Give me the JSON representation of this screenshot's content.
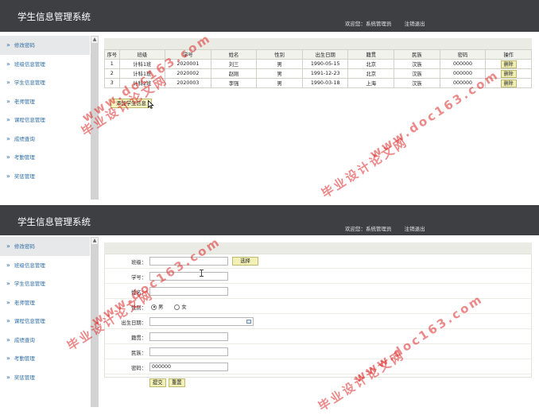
{
  "app": {
    "title": "学生信息管理系统",
    "welcome": "欢迎您：系统管理员",
    "logout": "注销退出"
  },
  "sidebar": {
    "items": [
      {
        "label": "修改密码"
      },
      {
        "label": "班级信息管理"
      },
      {
        "label": "学生信息管理"
      },
      {
        "label": "老师管理"
      },
      {
        "label": "课程信息管理"
      },
      {
        "label": "成绩查询"
      },
      {
        "label": "考勤管理"
      },
      {
        "label": "奖惩管理"
      }
    ]
  },
  "list_view": {
    "columns": [
      "序号",
      "班级",
      "学号",
      "姓名",
      "性别",
      "出生日期",
      "籍贯",
      "民族",
      "密码",
      "操作"
    ],
    "rows": [
      {
        "no": "1",
        "class": "计科1班",
        "id": "2020001",
        "name": "刘三",
        "gender": "男",
        "birth": "1990-05-15",
        "native": "北京",
        "ethnic": "汉族",
        "password": "000000",
        "action": "删除"
      },
      {
        "no": "2",
        "class": "计科1班",
        "id": "2020002",
        "name": "赵刚",
        "gender": "男",
        "birth": "1991-12-23",
        "native": "北京",
        "ethnic": "汉族",
        "password": "000000",
        "action": "删除"
      },
      {
        "no": "3",
        "class": "计科2班",
        "id": "2020003",
        "name": "李强",
        "gender": "男",
        "birth": "1990-03-18",
        "native": "上海",
        "ethnic": "汉族",
        "password": "000000",
        "action": "删除"
      }
    ],
    "add_button": "添加学生信息"
  },
  "form_view": {
    "class_label": "班级：",
    "select_button": "选择",
    "id_label": "学号：",
    "name_label": "姓名：",
    "gender_label": "性别：",
    "gender_male": "男",
    "gender_female": "女",
    "birth_label": "出生日期：",
    "native_label": "籍贯：",
    "ethnic_label": "民族：",
    "password_label": "密码：",
    "password_value": "000000",
    "submit_button": "提交",
    "reset_button": "重置"
  },
  "watermarks": {
    "site": "www.doc163.com",
    "cn": "毕业设计论文网"
  }
}
